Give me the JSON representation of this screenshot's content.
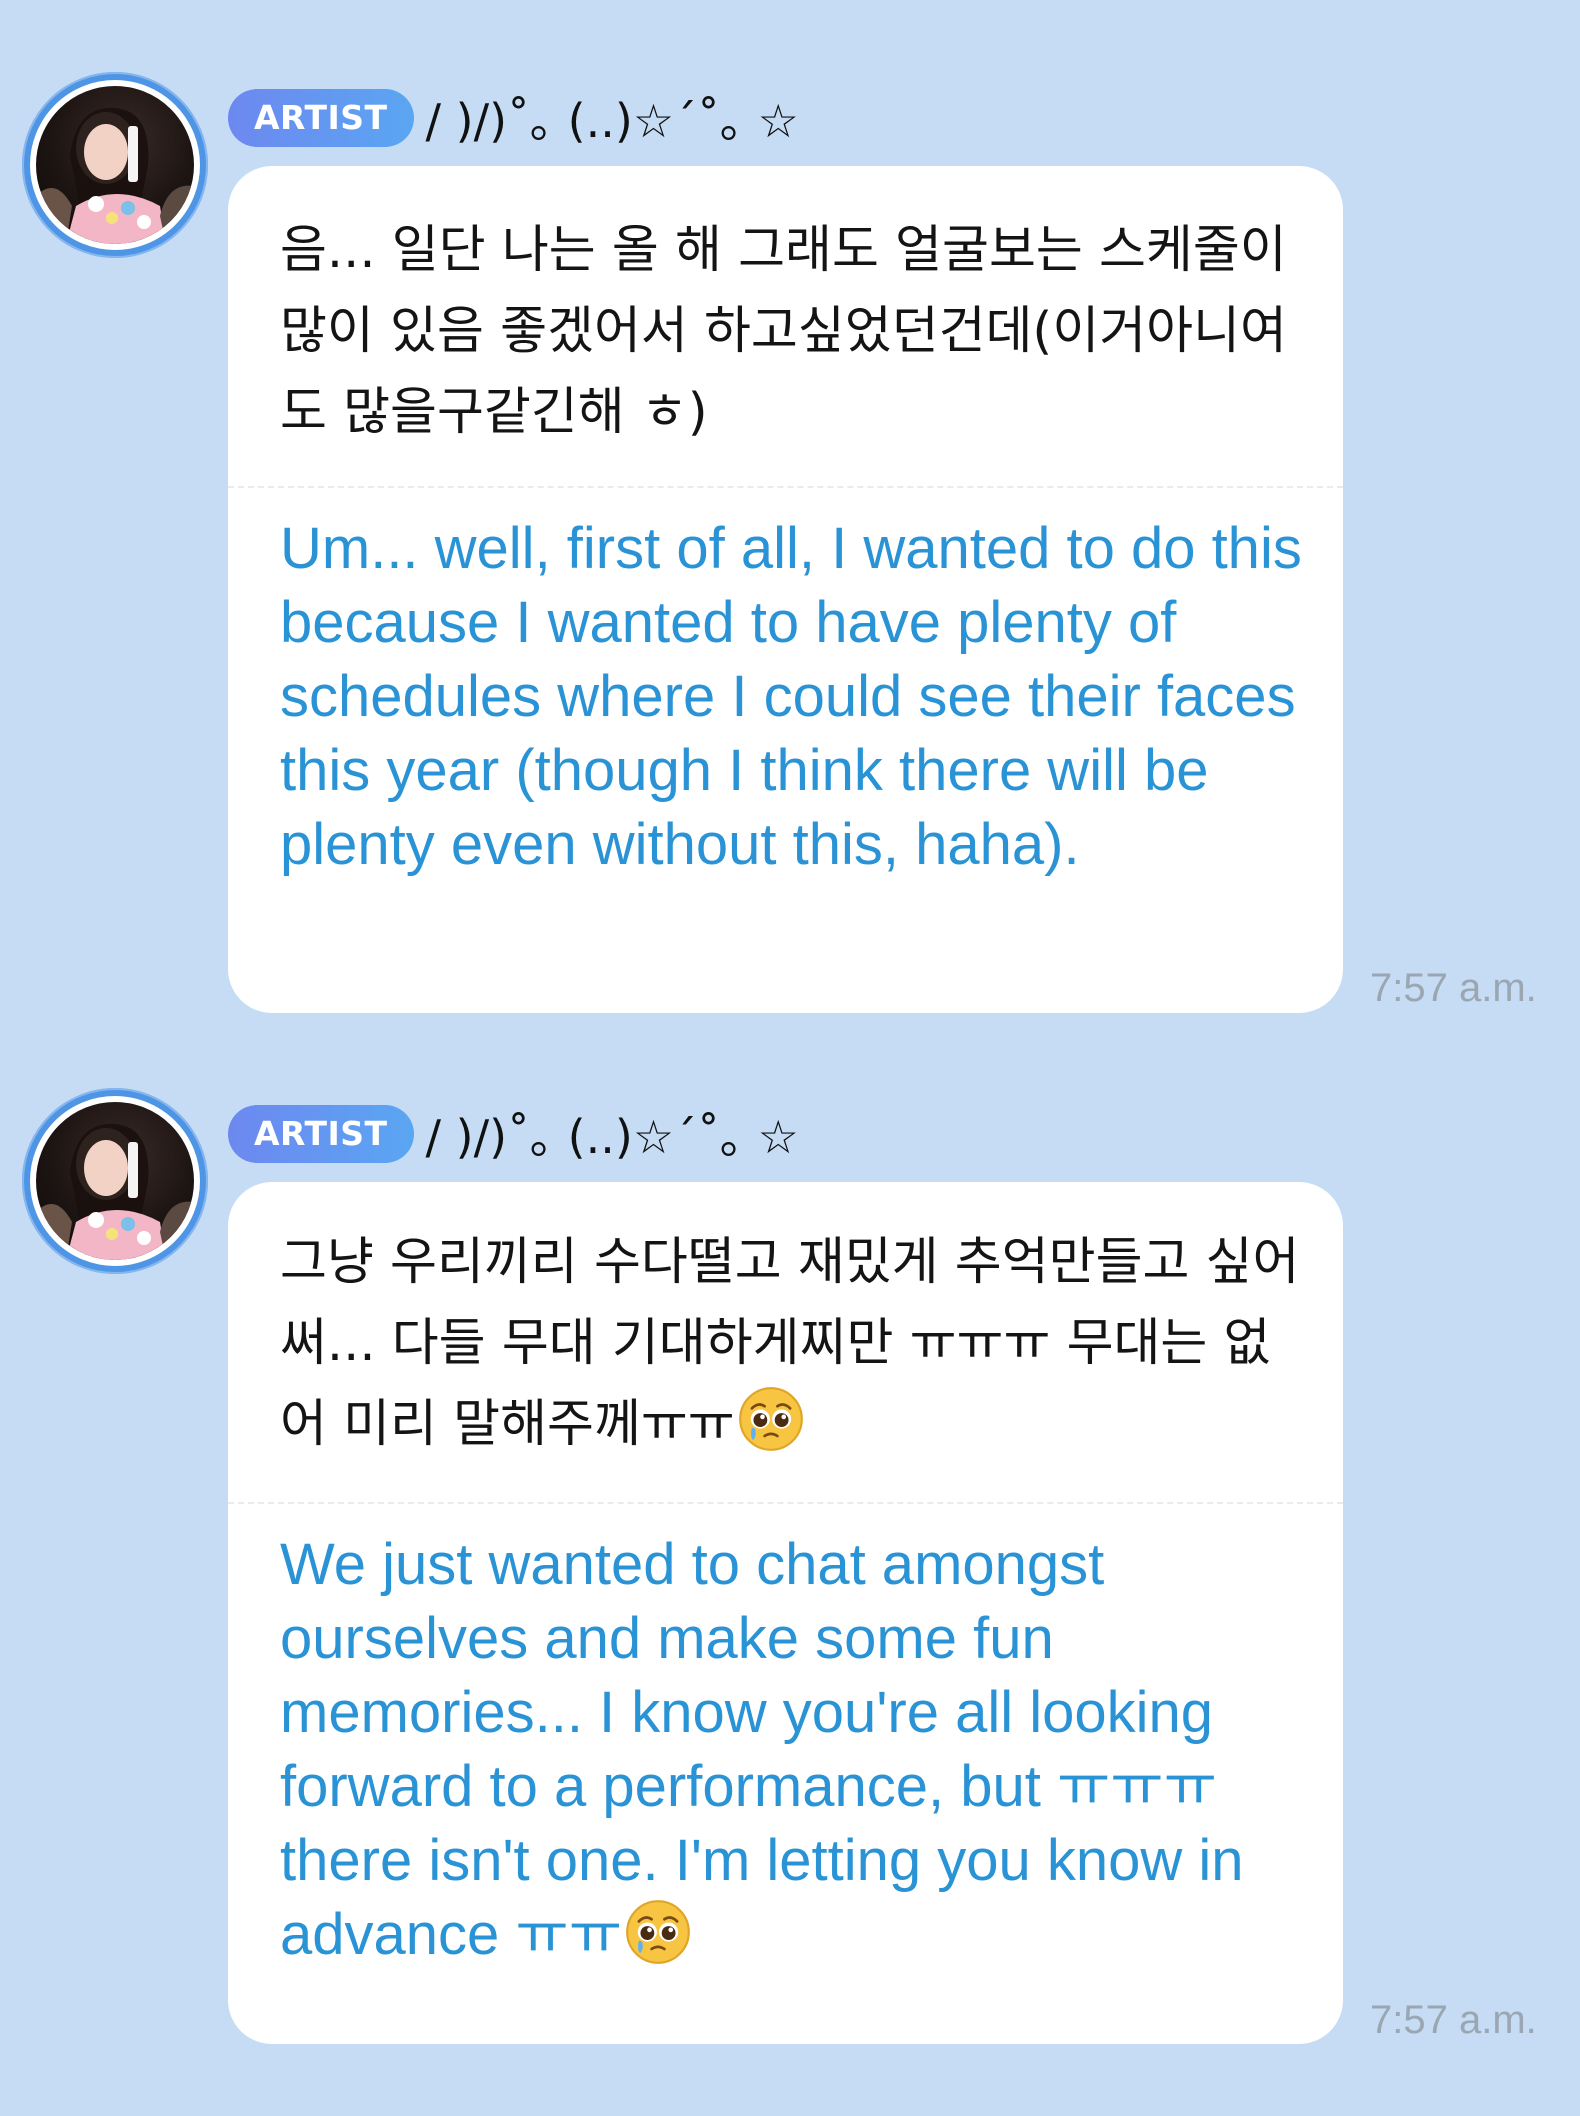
{
  "colors": {
    "background": "#c5dcf4",
    "bubble": "#ffffff",
    "translation_text": "#2a93d5",
    "badge_start": "#6d88f0",
    "badge_end": "#5aa6f2",
    "avatar_ring": "#4f95e6",
    "timestamp": "#9aa6b2"
  },
  "messages": [
    {
      "badge": "ARTIST",
      "sender": "/ )/)˚｡ (..)☆´˚｡ ☆",
      "korean": " 음... 일단 나는 올 해 그래도 얼굴보는 스케줄이 많이 있음 좋겠어서 하고싶었던건데(이거아니여도 많을구같긴해 ㅎ)",
      "english": "Um... well, first of all, I wanted to do this because I wanted to have plenty of schedules where I could see their faces this year (though I think there will be plenty even without this, haha).",
      "timestamp": "7:57 a.m."
    },
    {
      "badge": "ARTIST",
      "sender": "/ )/)˚｡ (..)☆´˚｡ ☆",
      "korean": "그냥 우리끼리 수다떨고 재밌게 추억만들고 싶어써... 다들 무대 기대하게찌만 ㅠㅠㅠ 무대는 없어 미리 말해주께ㅠㅠ",
      "korean_emoji": "pleading-face-icon",
      "english": "We just wanted to chat amongst ourselves and make some fun memories... I know you're all looking forward to a performance, but ㅠㅠㅠ there isn't one. I'm letting you know in advance ㅠㅠ",
      "english_emoji": "pleading-face-icon",
      "timestamp": "7:57 a.m."
    }
  ]
}
